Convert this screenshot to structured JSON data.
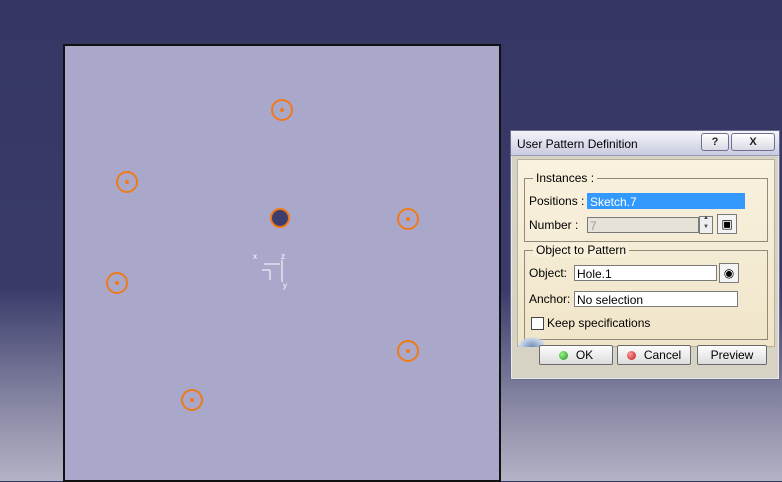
{
  "dialog": {
    "title": "User Pattern Definition",
    "help_label": "?",
    "close_label": "X",
    "instances": {
      "legend": "Instances :",
      "positions_label": "Positions :",
      "positions_value": "Sketch.7",
      "number_label": "Number :",
      "number_value": "7"
    },
    "object_group": {
      "legend": "Object to Pattern",
      "object_label": "Object:",
      "object_value": "Hole.1",
      "anchor_label": "Anchor:",
      "anchor_value": "No selection",
      "keep_spec_label": "Keep specifications",
      "keep_spec_checked": false
    },
    "buttons": {
      "ok": "OK",
      "cancel": "Cancel",
      "preview": "Preview"
    }
  },
  "viewport": {
    "axis_h": "x",
    "axis_v1": "z",
    "axis_v2": "y"
  },
  "colors": {
    "marker": "#f07a1a",
    "plane": "#a9a8cb",
    "background": "#353664",
    "selection": "#3399ff"
  }
}
